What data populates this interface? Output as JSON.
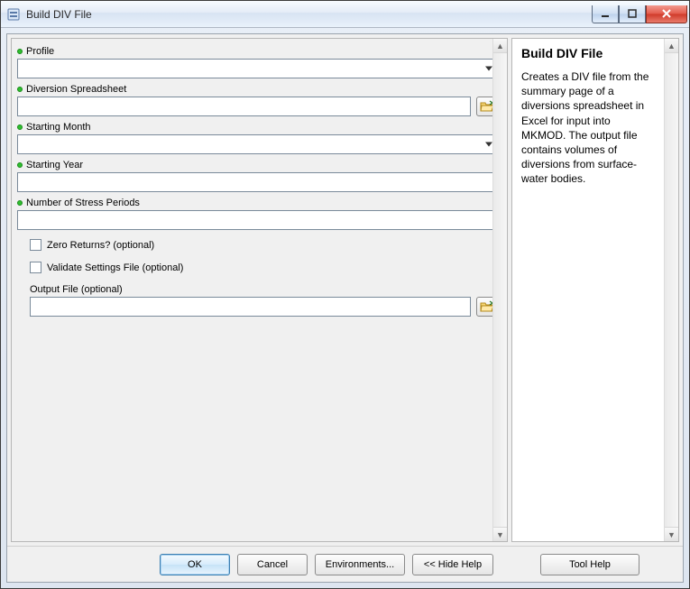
{
  "window": {
    "title": "Build DIV File"
  },
  "form": {
    "profile": {
      "label": "Profile",
      "value": ""
    },
    "diversion_spreadsheet": {
      "label": "Diversion Spreadsheet",
      "value": ""
    },
    "starting_month": {
      "label": "Starting Month",
      "value": ""
    },
    "starting_year": {
      "label": "Starting Year",
      "value": ""
    },
    "stress_periods": {
      "label": "Number of Stress Periods",
      "value": ""
    },
    "zero_returns": {
      "label": "Zero Returns? (optional)",
      "checked": false
    },
    "validate_settings": {
      "label": "Validate Settings File (optional)",
      "checked": false
    },
    "output_file": {
      "label": "Output File (optional)",
      "value": ""
    }
  },
  "buttons": {
    "ok": "OK",
    "cancel": "Cancel",
    "environments": "Environments...",
    "hide_help": "<< Hide Help",
    "tool_help": "Tool Help"
  },
  "help": {
    "title": "Build DIV File",
    "body": "Creates a DIV file from the summary page of a diversions spreadsheet in Excel for input into MKMOD. The output file contains volumes of diversions from surface-water bodies."
  },
  "icons": {
    "browse": "folder-open-icon"
  }
}
